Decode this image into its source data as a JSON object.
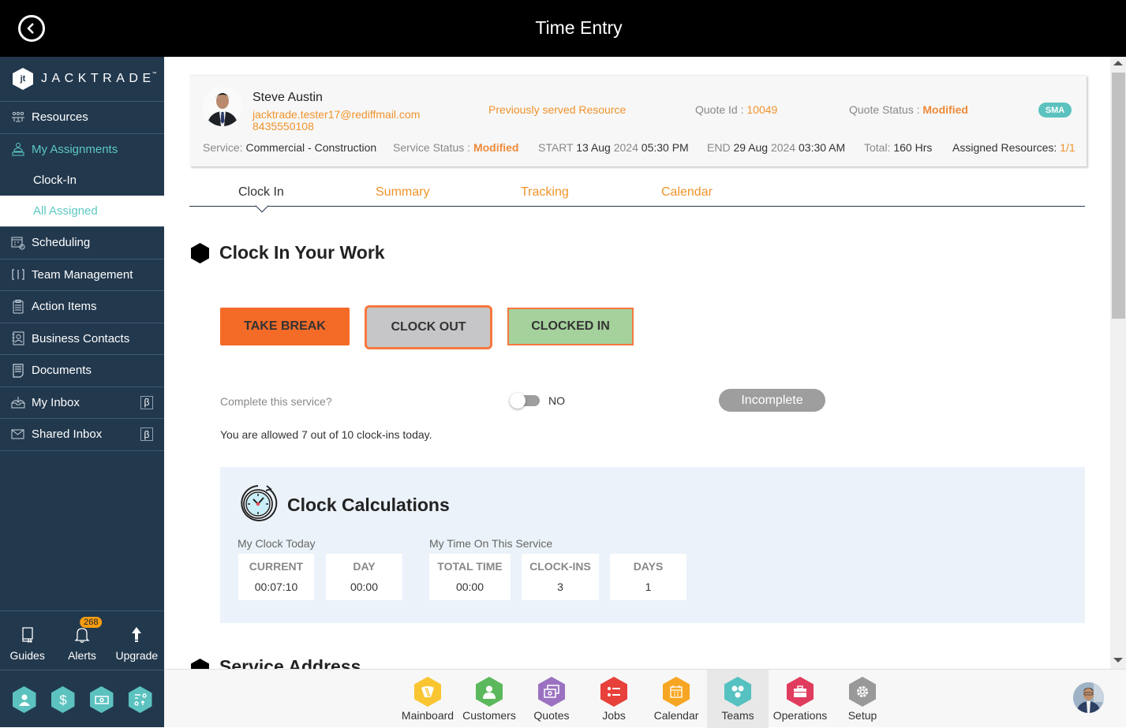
{
  "topbar": {
    "title": "Time Entry",
    "back_icon": "chevron-left-circle-icon"
  },
  "sidebar": {
    "logo_text": "JACKTRADE",
    "logo_tm": "™",
    "logo_mark": "jt",
    "items": [
      {
        "label": "Resources",
        "icon": "resources-icon"
      },
      {
        "label": "My Assignments",
        "icon": "assignments-icon",
        "active": true
      },
      {
        "label": "Scheduling",
        "icon": "scheduling-icon"
      },
      {
        "label": "Team Management",
        "icon": "team-management-icon"
      },
      {
        "label": "Action Items",
        "icon": "clipboard-icon"
      },
      {
        "label": "Business Contacts",
        "icon": "contacts-icon"
      },
      {
        "label": "Documents",
        "icon": "document-icon"
      },
      {
        "label": "My Inbox",
        "icon": "inbox-icon",
        "beta": "β"
      },
      {
        "label": "Shared Inbox",
        "icon": "mail-icon",
        "beta": "β"
      }
    ],
    "subitems": [
      {
        "label": "Clock-In"
      },
      {
        "label": "All Assigned",
        "selected": true
      }
    ],
    "utilities": [
      {
        "label": "Guides",
        "icon": "book-icon"
      },
      {
        "label": "Alerts",
        "icon": "bell-icon",
        "badge": "268"
      },
      {
        "label": "Upgrade",
        "icon": "arrow-up-icon"
      }
    ],
    "quick_icons": [
      "user-icon",
      "dollar-icon",
      "money-icon",
      "workflow-icon"
    ]
  },
  "card": {
    "name": "Steve Austin",
    "email": "jacktrade.tester17@rediffmail.com",
    "phone": "8435550108",
    "prev_served": "Previously served Resource",
    "quote_id_label": "Quote Id : ",
    "quote_id": "10049",
    "quote_status_label": "Quote Status : ",
    "quote_status": "Modified",
    "badge": "SMA",
    "service_label": "Service: ",
    "service": "Commercial - Construction",
    "service_status_label": "Service Status : ",
    "service_status": "Modified",
    "start_label": "START ",
    "start_date": "13 Aug",
    "start_year": " 2024 ",
    "start_time": "05:30 PM",
    "end_label": "END ",
    "end_date": "29 Aug",
    "end_year": " 2024 ",
    "end_time": "03:30 AM",
    "total_label": "Total: ",
    "total": "160 Hrs",
    "assigned_label": "Assigned Resources: ",
    "assigned": "1/1"
  },
  "tabs": [
    {
      "label": "Clock In",
      "active": true
    },
    {
      "label": "Summary"
    },
    {
      "label": "Tracking"
    },
    {
      "label": "Calendar"
    }
  ],
  "clock": {
    "section_title": "Clock In Your Work",
    "take_break": "TAKE BREAK",
    "clock_out": "CLOCK OUT",
    "clocked_in": "CLOCKED IN",
    "complete_label": "Complete this service?",
    "toggle_state": "NO",
    "status_button": "Incomplete",
    "allowed_text": "You are allowed 7 out of 10 clock-ins today."
  },
  "calc": {
    "title": "Clock Calculations",
    "today_label": "My Clock Today",
    "service_label": "My Time On This Service",
    "stats": [
      {
        "header": "CURRENT",
        "value": "00:07:10"
      },
      {
        "header": "DAY",
        "value": "00:00"
      },
      {
        "header": "TOTAL TIME",
        "value": "00:00"
      },
      {
        "header": "CLOCK-INS",
        "value": "3"
      },
      {
        "header": "DAYS",
        "value": "1"
      }
    ]
  },
  "next_section": "Service Address",
  "dock": {
    "items": [
      {
        "label": "Mainboard",
        "color": "#f9c531"
      },
      {
        "label": "Customers",
        "color": "#5cb85c"
      },
      {
        "label": "Quotes",
        "color": "#9b72c1"
      },
      {
        "label": "Jobs",
        "color": "#e8403a"
      },
      {
        "label": "Calendar",
        "color": "#f6a623"
      },
      {
        "label": "Teams",
        "color": "#56c1c1",
        "active": true
      },
      {
        "label": "Operations",
        "color": "#e03c5e"
      },
      {
        "label": "Setup",
        "color": "#999999"
      }
    ]
  },
  "colors": {
    "accent_orange": "#f0932b",
    "sidebar": "#22384d",
    "teal": "#5cc2bf"
  }
}
